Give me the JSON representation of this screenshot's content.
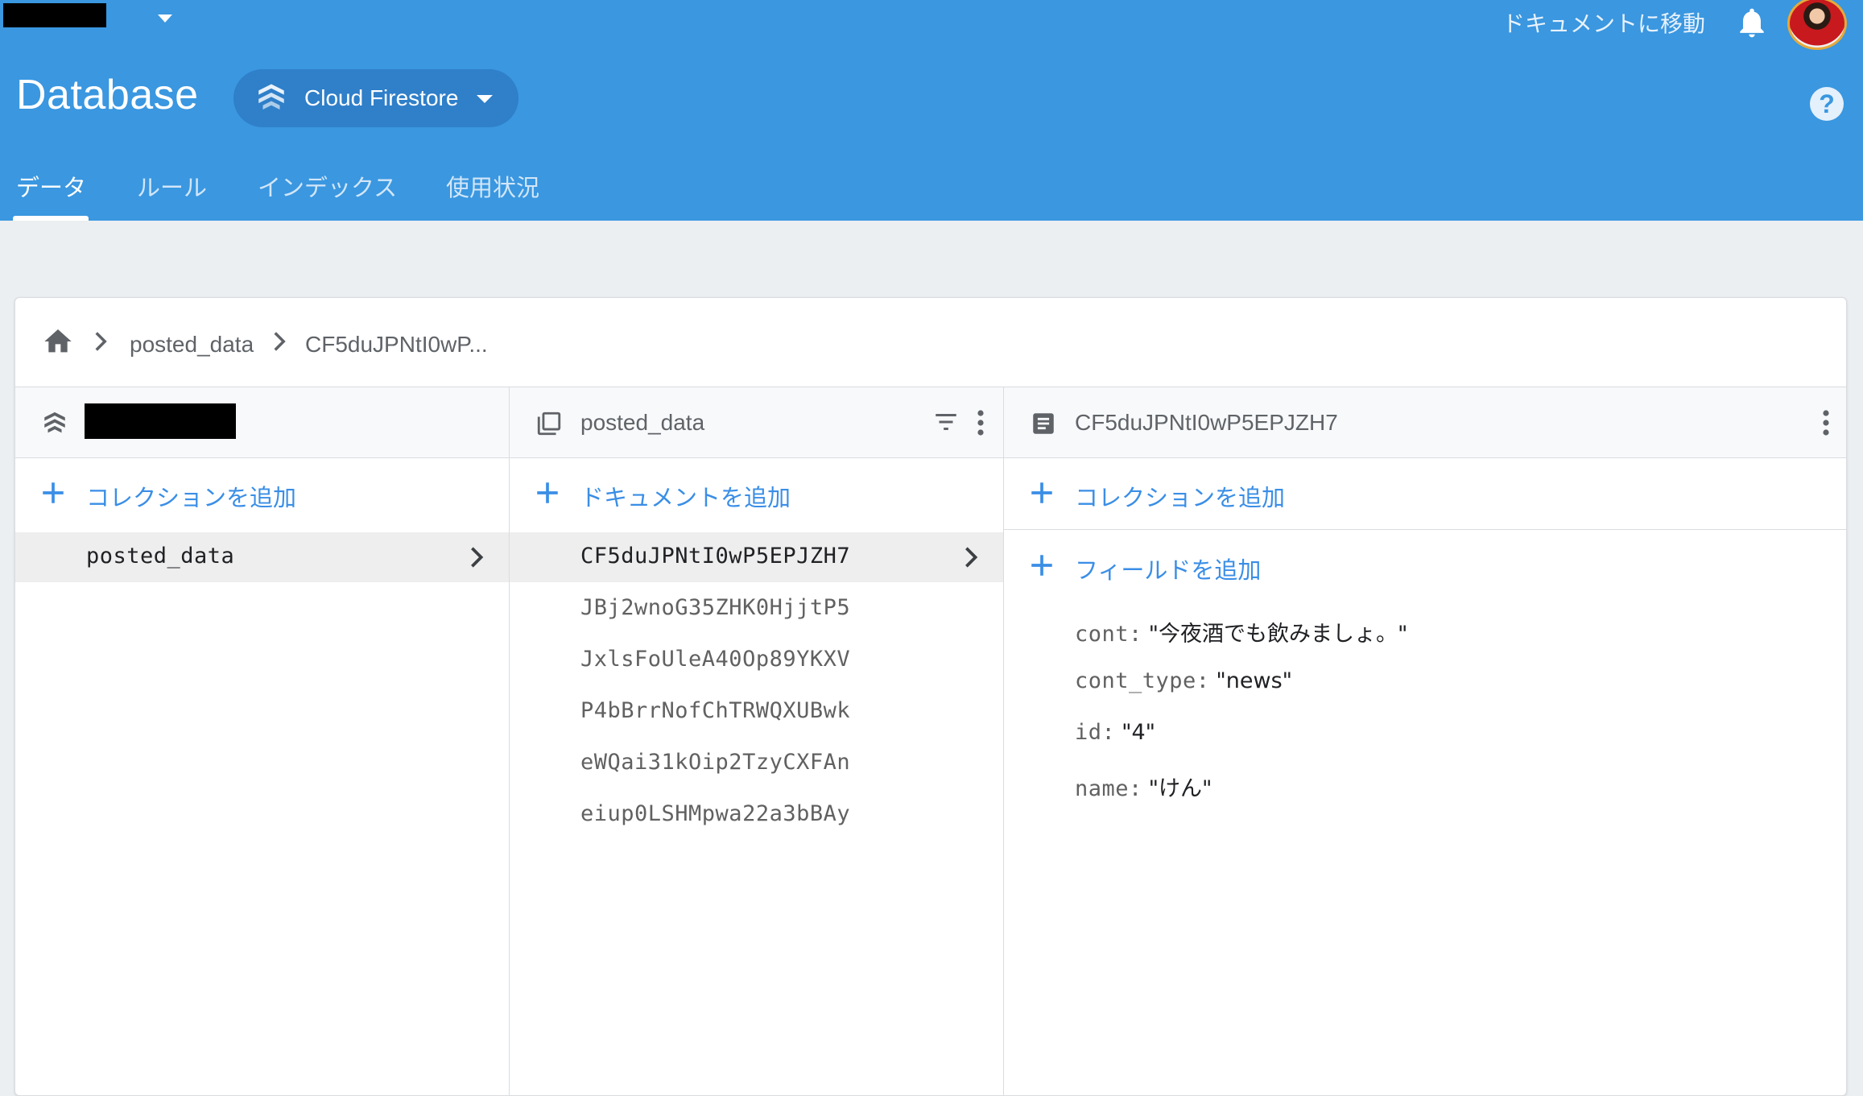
{
  "header": {
    "doc_link": "ドキュメントに移動",
    "title": "Database",
    "product": "Cloud Firestore",
    "help": "?",
    "tabs": [
      {
        "label": "データ",
        "active": true
      },
      {
        "label": "ルール",
        "active": false
      },
      {
        "label": "インデックス",
        "active": false
      },
      {
        "label": "使用状況",
        "active": false
      }
    ]
  },
  "breadcrumb": {
    "items": [
      "posted_data",
      "CF5duJPNtI0wP..."
    ]
  },
  "columns": {
    "root": {
      "add_label": "コレクションを追加",
      "items": [
        {
          "label": "posted_data",
          "selected": true
        }
      ]
    },
    "collection": {
      "name": "posted_data",
      "add_label": "ドキュメントを追加",
      "items": [
        {
          "label": "CF5duJPNtI0wP5EPJZH7",
          "selected": true
        },
        {
          "label": "JBj2wnoG35ZHK0HjjtP5"
        },
        {
          "label": "JxlsFoUleA40Op89YKXV"
        },
        {
          "label": "P4bBrrNofChTRWQXUBwk"
        },
        {
          "label": "eWQai31kOip2TzyCXFAn"
        },
        {
          "label": "eiup0LSHMpwa22a3bBAy"
        }
      ]
    },
    "document": {
      "name": "CF5duJPNtI0wP5EPJZH7",
      "add_collection_label": "コレクションを追加",
      "add_field_label": "フィールドを追加",
      "fields": [
        {
          "key": "cont:",
          "value": "\"今夜酒でも飲みましょ。\""
        },
        {
          "key": "cont_type:",
          "value": "\"news\""
        },
        {
          "key": "id:",
          "value": "\"4\""
        },
        {
          "key": "name:",
          "value": "\"けん\""
        }
      ]
    }
  },
  "colors": {
    "brand": "#3a97e0",
    "accent": "#3a8ee6",
    "pill": "#2f7fc9"
  },
  "icons": [
    "notifications-icon",
    "help-icon",
    "firestore-stack-icon",
    "home-icon",
    "chevron-right-icon",
    "collection-icon",
    "document-icon",
    "filter-icon",
    "more-vert-icon",
    "add-icon"
  ]
}
